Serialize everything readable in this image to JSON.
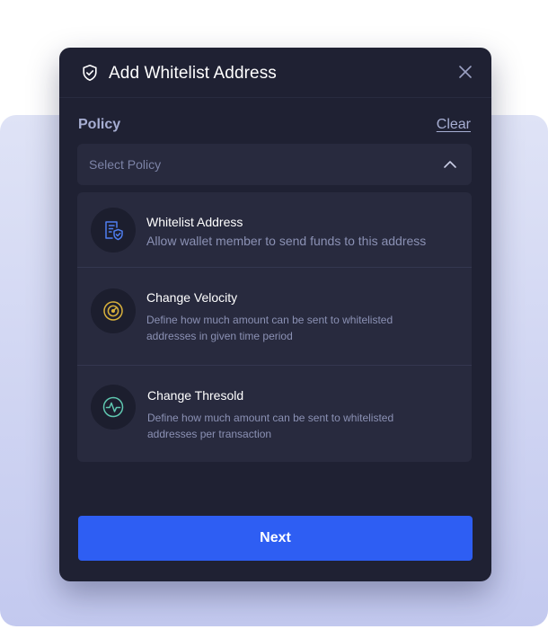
{
  "modal": {
    "title": "Add Whitelist Address",
    "header_icon": "shield-check-icon",
    "close_icon": "close-icon"
  },
  "policy": {
    "label": "Policy",
    "clear_label": "Clear",
    "select_placeholder": "Select Policy",
    "chevron_icon": "chevron-up-icon",
    "options": [
      {
        "title": "Whitelist Address",
        "description": "Allow wallet member to send funds to this address",
        "icon": "document-shield-icon",
        "icon_color": "#4f7ef0"
      },
      {
        "title": "Change Velocity",
        "description": "Define how much amount can be sent to whitelisted addresses in given time period",
        "icon": "speedometer-icon",
        "icon_color": "#d8b13c"
      },
      {
        "title": "Change Thresold",
        "description": "Define how much amount can be sent to whitelisted addresses per transaction",
        "icon": "pulse-icon",
        "icon_color": "#5fc7b0"
      }
    ]
  },
  "footer": {
    "next_label": "Next"
  },
  "colors": {
    "modal_bg": "#1f2133",
    "panel_bg": "#282a3e",
    "accent": "#2e5ef3",
    "muted_text": "#a7aed3"
  }
}
